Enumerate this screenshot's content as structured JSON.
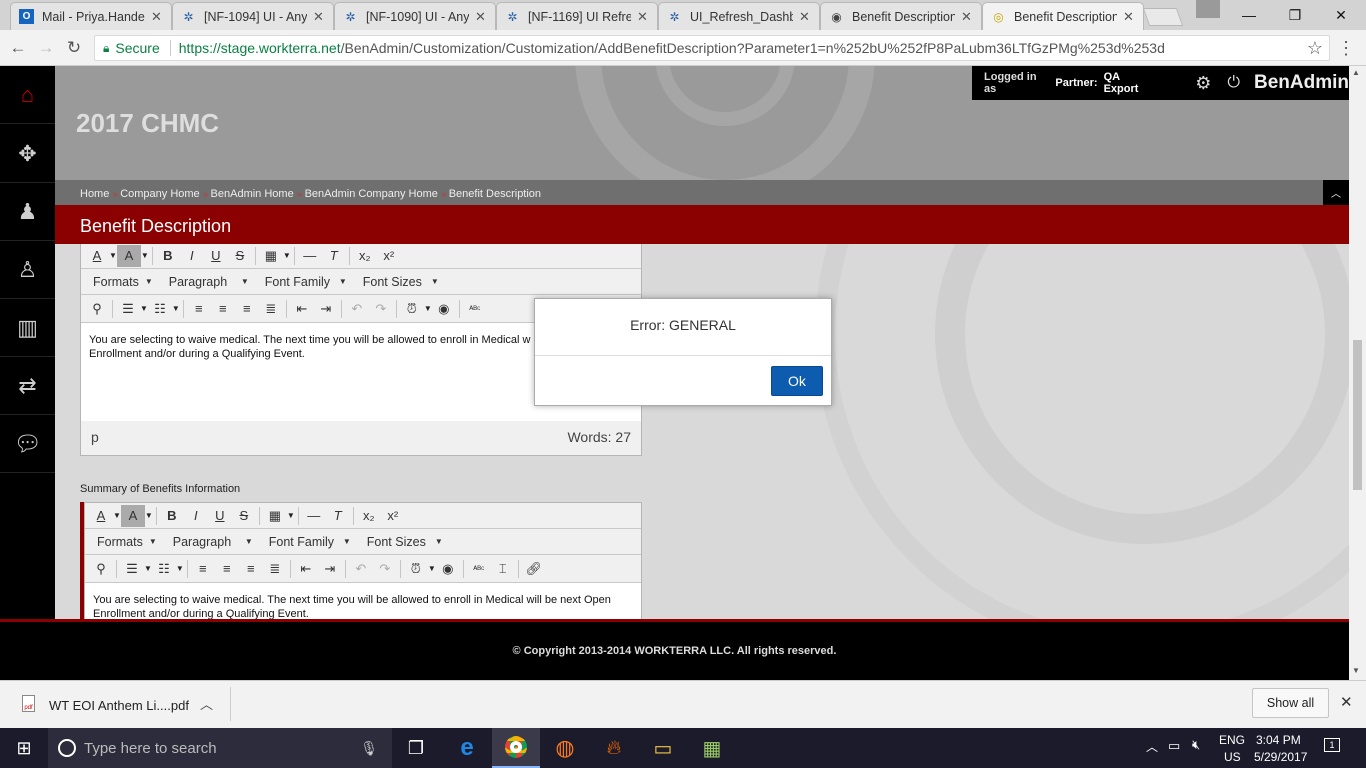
{
  "browser": {
    "tabs": [
      {
        "title": "Mail - Priya.Hande;",
        "icon": "outlook-icon"
      },
      {
        "title": "[NF-1094] UI - Any",
        "icon": "jira-icon"
      },
      {
        "title": "[NF-1090] UI - Any",
        "icon": "jira-icon"
      },
      {
        "title": "[NF-1169] UI Refre",
        "icon": "jira-icon"
      },
      {
        "title": "UI_Refresh_Dashbc",
        "icon": "jira-icon"
      },
      {
        "title": "Benefit Description",
        "icon": "page-icon"
      },
      {
        "title": "Benefit Description",
        "icon": "page-icon",
        "active": true
      }
    ],
    "secure_label": "Secure",
    "url_host": "https://stage.workterra.net",
    "url_path": "/BenAdmin/Customization/Customization/AddBenefitDescription?Parameter1=n%252bU%252fP8PaLubm36LTfGzPMg%253d%253d"
  },
  "app": {
    "logged_in_prefix": "Logged in as",
    "partner_label": "Partner:",
    "partner_name": "QA Export",
    "brand": "BenAdmin",
    "company_title": "2017 CHMC",
    "breadcrumb": [
      "Home",
      "Company Home",
      "BenAdmin Home",
      "BenAdmin Company Home",
      "Benefit Description"
    ],
    "page_title": "Benefit Description",
    "editor1": {
      "body_text": "You are selecting to waive medical. The next time you will be allowed to enroll in Medical w",
      "body_text2": "Enrollment and/or during a Qualifying Event.",
      "path": "p",
      "words": "Words: 27"
    },
    "section_label": "Summary of Benefits Information",
    "editor2": {
      "body_text": "You are selecting to waive medical. The next time you will be allowed to enroll in Medical will be next Open",
      "body_text2": "Enrollment and/or during a Qualifying Event."
    },
    "toolbar": {
      "formats": "Formats",
      "paragraph": "Paragraph",
      "font_family": "Font Family",
      "font_sizes": "Font Sizes"
    },
    "footer": "© Copyright 2013-2014 WORKTERRA LLC. All rights reserved."
  },
  "dialog": {
    "message": "Error: GENERAL",
    "ok_label": "Ok"
  },
  "downloads": {
    "file_name": "WT EOI Anthem Li....pdf",
    "show_all": "Show all"
  },
  "taskbar": {
    "search_placeholder": "Type here to search",
    "lang": "ENG",
    "region": "US",
    "time": "3:04 PM",
    "date": "5/29/2017",
    "notifications": "1"
  },
  "colors": {
    "brand_red": "#8b0000",
    "ok_blue": "#0d5cb0"
  }
}
